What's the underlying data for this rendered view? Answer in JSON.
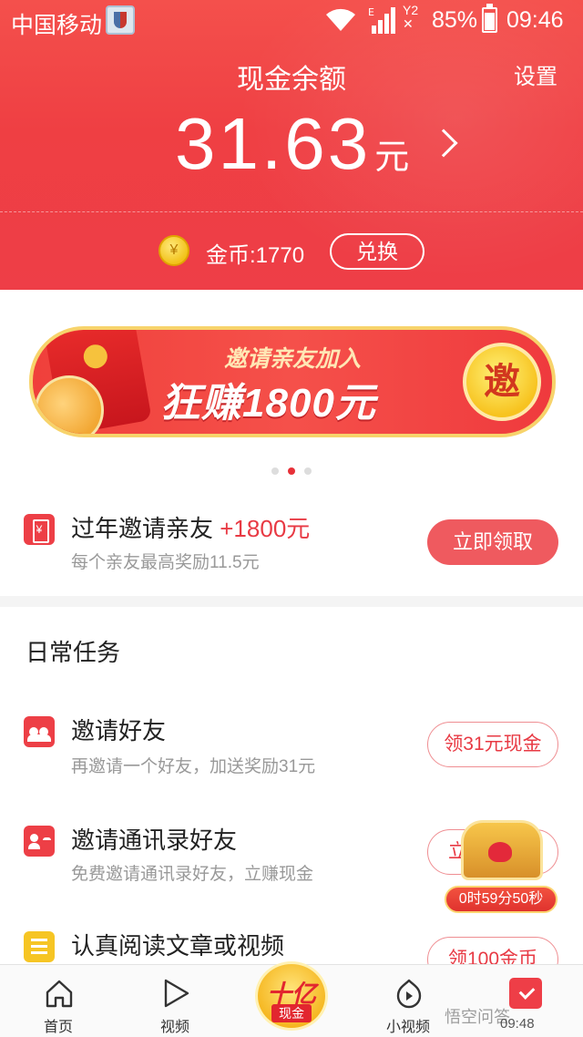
{
  "status_bar": {
    "carrier": "中国移动",
    "signal_label": "E",
    "sim2_label": "Y2",
    "battery_pct": "85%",
    "time": "09:46"
  },
  "header": {
    "title": "现金余额",
    "settings_label": "设置",
    "balance_amount": "31.63",
    "balance_unit": "元",
    "coins_text": "金币:1770",
    "exchange_label": "兑换"
  },
  "banner": {
    "subtitle": "邀请亲友加入",
    "headline": "狂赚1800元",
    "invite_button": "邀",
    "pager": {
      "count": 3,
      "active": 1
    }
  },
  "promo": {
    "title": "过年邀请亲友",
    "title_accent": "+1800元",
    "subtitle": "每个亲友最高奖励11.5元",
    "button": "立即领取"
  },
  "daily_tasks": {
    "heading": "日常任务",
    "items": [
      {
        "title": "邀请好友",
        "subtitle": "再邀请一个好友，加送奖励31元",
        "button": "领31元现金",
        "icon": "people-icon"
      },
      {
        "title": "邀请通讯录好友",
        "subtitle": "免费邀请通讯录好友，立赚现金",
        "button": "立",
        "icon": "contact-card-icon"
      },
      {
        "title": "认真阅读文章或视频",
        "subtitle": "",
        "button": "领100金币",
        "icon": "document-icon"
      }
    ],
    "treasure_timer": "0时59分50秒"
  },
  "bottom_nav": {
    "items": [
      {
        "label": "首页",
        "icon": "home-icon"
      },
      {
        "label": "视频",
        "icon": "play-icon"
      },
      {
        "label": "",
        "icon": "cash-badge-icon"
      },
      {
        "label": "小视频",
        "icon": "small-video-icon"
      },
      {
        "label": "",
        "icon": "calendar-check-icon"
      }
    ],
    "cash_badge_top": "十亿",
    "cash_badge_bottom": "现金",
    "calendar_time": "09:48"
  },
  "watermark": "悟空问答",
  "colors": {
    "brand_red": "#ee3e47",
    "accent_gold": "#f6c524"
  }
}
